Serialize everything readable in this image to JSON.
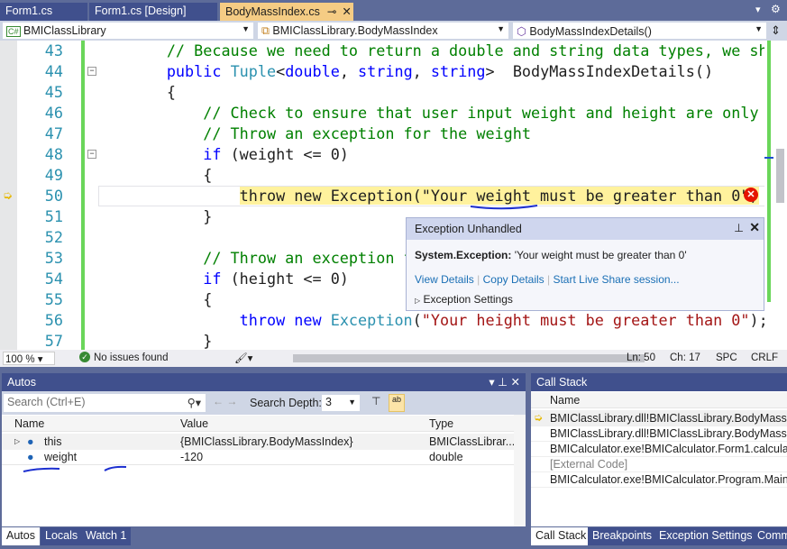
{
  "tabs": [
    {
      "label": "Form1.cs"
    },
    {
      "label": "Form1.cs [Design]"
    },
    {
      "label": "BodyMassIndex.cs",
      "active": true
    }
  ],
  "nav": {
    "project": "BMIClassLibrary",
    "class": "BMIClassLibrary.BodyMassIndex",
    "member": "BodyMassIndexDetails()"
  },
  "code": [
    {
      "n": "43",
      "tokens": [
        [
          "        ",
          "p"
        ],
        [
          "// Because we need to return a double and string data types, we sha",
          "c"
        ]
      ]
    },
    {
      "n": "44",
      "tokens": [
        [
          "        ",
          "p"
        ],
        [
          "public",
          "k"
        ],
        [
          " ",
          "p"
        ],
        [
          "Tuple",
          "t"
        ],
        [
          "<",
          "p"
        ],
        [
          "double",
          "k"
        ],
        [
          ", ",
          "p"
        ],
        [
          "string",
          "k"
        ],
        [
          ", ",
          "p"
        ],
        [
          "string",
          "k"
        ],
        [
          ">  BodyMassIndexDetails()",
          "p"
        ]
      ]
    },
    {
      "n": "45",
      "tokens": [
        [
          "        {",
          "p"
        ]
      ]
    },
    {
      "n": "46",
      "tokens": [
        [
          "            ",
          "p"
        ],
        [
          "// Check to ensure that user input weight and height are only p",
          "c"
        ]
      ]
    },
    {
      "n": "47",
      "tokens": [
        [
          "            ",
          "p"
        ],
        [
          "// Throw an exception for the weight",
          "c"
        ]
      ]
    },
    {
      "n": "48",
      "tokens": [
        [
          "            ",
          "p"
        ],
        [
          "if",
          "k"
        ],
        [
          " (weight <= 0)",
          "p"
        ]
      ]
    },
    {
      "n": "49",
      "tokens": [
        [
          "            {",
          "p"
        ]
      ]
    },
    {
      "n": "50",
      "tokens": [
        [
          "                ",
          "p"
        ],
        [
          "throw new Exception(\"Your weight must be greater than 0\")",
          "p hl"
        ]
      ]
    },
    {
      "n": "51",
      "tokens": [
        [
          "            }",
          "p"
        ]
      ]
    },
    {
      "n": "52",
      "tokens": [
        [
          "",
          "p"
        ]
      ]
    },
    {
      "n": "53",
      "tokens": [
        [
          "            ",
          "p"
        ],
        [
          "// Throw an exception f",
          "c"
        ]
      ]
    },
    {
      "n": "54",
      "tokens": [
        [
          "            ",
          "p"
        ],
        [
          "if",
          "k"
        ],
        [
          " (height <= 0)",
          "p"
        ]
      ]
    },
    {
      "n": "55",
      "tokens": [
        [
          "            {",
          "p"
        ]
      ]
    },
    {
      "n": "56",
      "tokens": [
        [
          "                ",
          "p"
        ],
        [
          "throw",
          "k"
        ],
        [
          " ",
          "p"
        ],
        [
          "new",
          "k"
        ],
        [
          " ",
          "p"
        ],
        [
          "Exception",
          "t"
        ],
        [
          "(",
          "p"
        ],
        [
          "\"Your height must be greater than 0\"",
          "s"
        ],
        [
          ");",
          "p"
        ]
      ]
    },
    {
      "n": "57",
      "tokens": [
        [
          "            }",
          "p"
        ]
      ]
    }
  ],
  "exception": {
    "title": "Exception Unhandled",
    "type": "System.Exception:",
    "message": "'Your weight must be greater than 0'",
    "links": [
      "View Details",
      "Copy Details",
      "Start Live Share session..."
    ],
    "settings": "Exception Settings"
  },
  "status": {
    "zoom": "100 %",
    "issues": "No issues found",
    "ln": "Ln: 50",
    "ch": "Ch: 17",
    "spc": "SPC",
    "crlf": "CRLF"
  },
  "autos": {
    "title": "Autos",
    "search_placeholder": "Search (Ctrl+E)",
    "depth_label": "Search Depth:",
    "depth": "3",
    "columns": [
      "Name",
      "Value",
      "Type"
    ],
    "rows": [
      {
        "name": "this",
        "value": "{BMIClassLibrary.BodyMassIndex}",
        "type": "BMIClassLibrar..."
      },
      {
        "name": "weight",
        "value": "-120",
        "type": "double"
      }
    ],
    "tabs": [
      "Autos",
      "Locals",
      "Watch 1"
    ]
  },
  "callstack": {
    "title": "Call Stack",
    "column": "Name",
    "rows": [
      "BMIClassLibrary.dll!BMIClassLibrary.BodyMassIndex",
      "BMIClassLibrary.dll!BMIClassLibrary.BodyMassIndex",
      "BMICalculator.exe!BMICalculator.Form1.calculateB",
      "[External Code]",
      "BMICalculator.exe!BMICalculator.Program.Main()"
    ],
    "tabs": [
      "Call Stack",
      "Breakpoints",
      "Exception Settings",
      "Comm"
    ]
  }
}
